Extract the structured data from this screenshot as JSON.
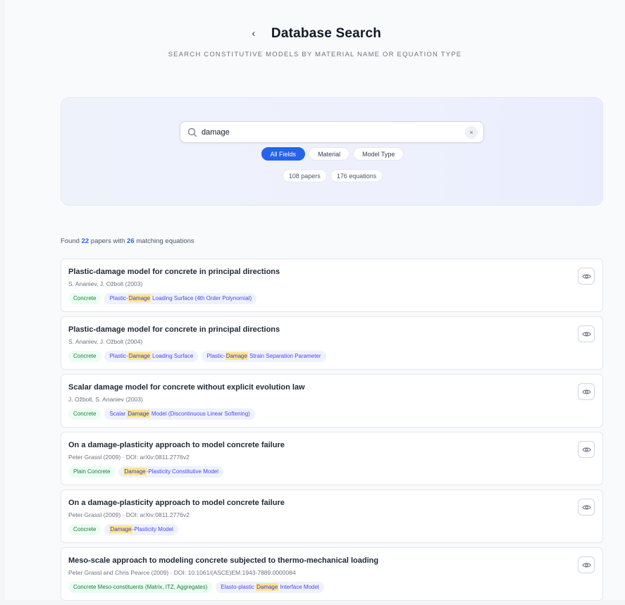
{
  "header": {
    "back_label": "‹",
    "title": "Database Search",
    "subtitle": "SEARCH CONSTITUTIVE MODELS BY MATERIAL NAME OR EQUATION TYPE"
  },
  "search": {
    "value": "damage",
    "clear_label": "×",
    "filters": [
      "All Fields",
      "Material",
      "Model Type"
    ],
    "active_filter": "All Fields",
    "stats": [
      "108 papers",
      "176 equations"
    ]
  },
  "summary": {
    "prefix": "Found ",
    "papers": "22",
    "middle": " papers with ",
    "equations": "26",
    "suffix": " matching equations"
  },
  "results": [
    {
      "title": "Plastic-damage model for concrete in principal directions",
      "meta": "S. Ananiev, J. Ožbolt (2003)",
      "material": "Concrete",
      "models": [
        {
          "pre": "Plastic-",
          "hl": "Damage",
          "post": " Loading Surface (4th Order Polynomial)"
        }
      ]
    },
    {
      "title": "Plastic-damage model for concrete in principal directions",
      "meta": "S. Ananiev, J. Ožbolt (2004)",
      "material": "Concrete",
      "models": [
        {
          "pre": "Plastic-",
          "hl": "Damage",
          "post": " Loading Surface"
        },
        {
          "pre": "Plastic-",
          "hl": "Damage",
          "post": " Strain Separation Parameter"
        }
      ]
    },
    {
      "title": "Scalar damage model for concrete without explicit evolution law",
      "meta": "J. Ožbolt, S. Ananiev (2003)",
      "material": "Concrete",
      "models": [
        {
          "pre": "Scalar ",
          "hl": "Damage",
          "post": " Model (Discontinuous Linear Softening)"
        }
      ]
    },
    {
      "title": "On a damage-plasticity approach to model concrete failure",
      "meta": "Peter Grassl (2009) · DOI: arXiv:0811.2776v2",
      "material": "Plain Concrete",
      "models": [
        {
          "pre": "",
          "hl": "Damage",
          "post": "-Plasticity Constitutive Model"
        }
      ]
    },
    {
      "title": "On a damage-plasticity approach to model concrete failure",
      "meta": "Peter Grassl (2009) · DOI: arXiv:0811.2776v2",
      "material": "Concrete",
      "models": [
        {
          "pre": "",
          "hl": "Damage",
          "post": "-Plasticity Model"
        }
      ]
    },
    {
      "title": "Meso-scale approach to modeling concrete subjected to thermo-mechanical loading",
      "meta": "Peter Grassl and Chris Pearce (2009) · DOI: 10.1061/(ASCE)EM.1943-7889.0000084",
      "material": "Concrete Meso-constituents (Matrix, ITZ, Aggregates)",
      "models": [
        {
          "pre": "Elasto-plastic ",
          "hl": "Damage",
          "post": " Interface Model"
        }
      ]
    }
  ]
}
